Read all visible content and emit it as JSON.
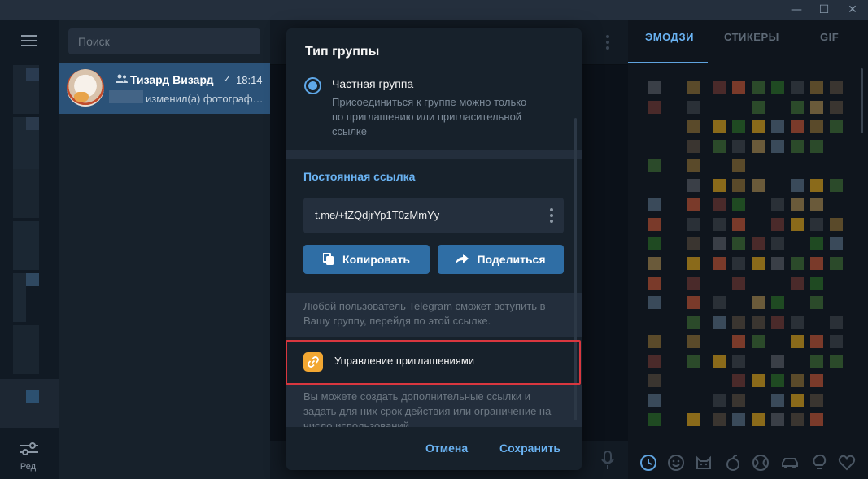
{
  "colors": {
    "accent": "#6ab3f3",
    "button_primary": "#2f6ea5",
    "highlight_box": "#d9373f",
    "manage_icon": "#f2a732",
    "selected_chat": "#2b5278"
  },
  "window": {
    "minimize_glyph": "—",
    "maximize_glyph": "☐",
    "close_glyph": "✕"
  },
  "sidebar": {
    "settings_label": "Ред."
  },
  "chatlist": {
    "search_placeholder": "Поиск",
    "chats": [
      {
        "name": "Тизард Визард",
        "time": "18:14",
        "preview": "изменил(а) фотограф…",
        "is_group": true,
        "read": true
      }
    ]
  },
  "emoji_panel": {
    "tabs": [
      "ЭМОДЗИ",
      "СТИКЕРЫ",
      "GIF"
    ],
    "active_tab": "ЭМОДЗИ",
    "categories": [
      "recent-icon",
      "smile-icon",
      "cat-icon",
      "food-icon",
      "sport-icon",
      "car-icon",
      "bulb-icon",
      "heart-icon"
    ]
  },
  "dialog": {
    "title": "Тип группы",
    "option_title": "Частная группа",
    "option_desc": "Присоединиться к группе можно только по приглашению или пригласительной ссылке",
    "link_header": "Постоянная ссылка",
    "link": "t.me/+fZQdjrYp1T0zMmYy",
    "copy_label": "Копировать",
    "share_label": "Поделиться",
    "note1": "Любой пользователь Telegram сможет вступить в Вашу группу, перейдя по этой ссылке.",
    "manage_label": "Управление приглашениями",
    "note2": "Вы можете создать дополнительные ссылки и задать для них срок действия или ограничение на число использований",
    "cancel_label": "Отмена",
    "save_label": "Сохранить"
  }
}
